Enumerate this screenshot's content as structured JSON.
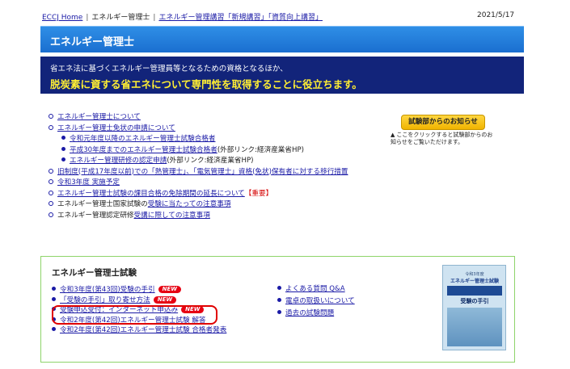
{
  "topbar": {
    "home": "ECCJ Home",
    "current": "エネルギー管理士",
    "links": [
      "エネルギー管理講習「新規講習」「資質向上講習」"
    ],
    "date": "2021/5/17"
  },
  "title_band": {
    "title": "エネルギー管理士"
  },
  "mission": {
    "line1": "省エネ法に基づくエネルギー管理員等となるための資格となるほか、",
    "line2": "脱炭素に資する省エネについて専門性を取得することに役立ちます。"
  },
  "main_list": [
    {
      "text": "エネルギー管理士について",
      "kind": "o",
      "link": true
    },
    {
      "text": "エネルギー管理士免状の申請について",
      "kind": "o",
      "link": true
    },
    {
      "text": "令和元年度以降のエネルギー管理士試験合格者",
      "kind": "d",
      "link": true,
      "sub": true
    },
    {
      "text": "平成30年度までのエネルギー管理士試験合格者",
      "suffix": "(外部リンク:経済産業省HP)",
      "kind": "d",
      "link": true,
      "sub": true
    },
    {
      "text": "エネルギー管理研修の認定申請",
      "suffix": "(外部リンク:経済産業省HP)",
      "kind": "d",
      "link": true,
      "sub": true
    },
    {
      "text": "旧制度(平成17年度以前)での「熱管理士」、「電気管理士」資格(免状)保有者に対する移行措置",
      "kind": "o",
      "link": true
    },
    {
      "text": "令和3年度 実施予定",
      "kind": "o",
      "link": true
    },
    {
      "text": "エネルギー管理士試験の課目合格の免除期間の延長について",
      "suffix": "【重要】",
      "suffix_red": true,
      "kind": "o",
      "link": true
    },
    {
      "text_plain": "エネルギー管理士国家試験の",
      "text": "受験に当たっての注意事項",
      "kind": "o",
      "link": true
    },
    {
      "text_plain": "エネルギー管理認定研修",
      "text": "受講に際しての注意事項",
      "kind": "o",
      "link": true
    }
  ],
  "notice": {
    "button": "試験部からのお知らせ",
    "note": "ここをクリックすると試験部からのお知らせをご覧いただけます。"
  },
  "exam": {
    "title": "エネルギー管理士試験",
    "new_label": "NEW",
    "items": [
      {
        "text": "令和3年度(第43回)受験の手引",
        "new": true
      },
      {
        "text": "「受験の手引」取り寄せ方法",
        "new": true
      },
      {
        "text": "受験申込受付：インターネット申込み",
        "new": true
      },
      {
        "text": "令和2年度(第42回)エネルギー管理士試験 解答",
        "new": false
      },
      {
        "text": "令和2年度(第42回)エネルギー管理士試験 合格者発表",
        "new": false
      }
    ],
    "faq": [
      "よくある質問 Q&A",
      "電卓の取扱いについて",
      "過去の試験問題"
    ]
  },
  "brochure": {
    "small": "令和3年度",
    "title": "エネルギー管理士試験",
    "subtitle": "受験の手引"
  }
}
